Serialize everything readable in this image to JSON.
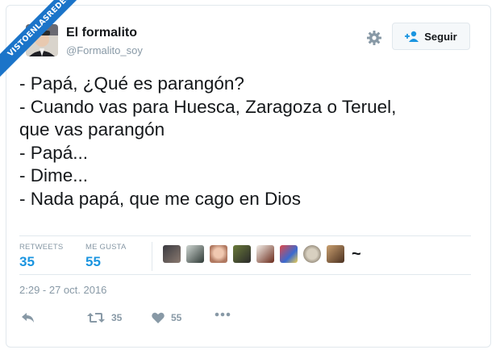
{
  "watermark": {
    "text": "VISTOENLASREDES"
  },
  "author": {
    "name": "El formalito",
    "handle": "@Formalito_soy"
  },
  "follow_button": {
    "label": "Seguir"
  },
  "tweet": {
    "lines": [
      "- Papá, ¿Qué es parangón?",
      "- Cuando vas para Huesca, Zaragoza o Teruel,",
      "que vas parangón",
      "- Papá...",
      "- Dime...",
      "- Nada papá, que me cago en Dios"
    ]
  },
  "stats": {
    "retweets_label": "RETWEETS",
    "retweets_value": "35",
    "likes_label": "ME GUSTA",
    "likes_value": "55"
  },
  "likers": {
    "more": "~"
  },
  "timestamp": "2:29 - 27 oct. 2016",
  "actions": {
    "retweet_count": "35",
    "like_count": "55"
  },
  "colors": {
    "accent": "#1b95e0",
    "watermark": "#1b74c9",
    "muted": "#8899a6",
    "border": "#e1e8ed"
  },
  "icons": [
    "gear-icon",
    "follow-person-icon",
    "reply-icon",
    "retweet-icon",
    "heart-icon",
    "more-icon"
  ]
}
